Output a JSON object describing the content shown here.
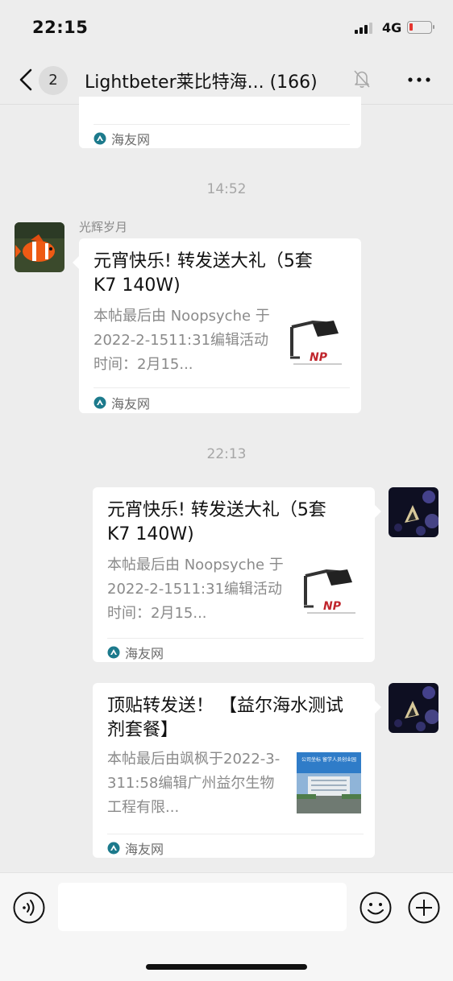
{
  "status_bar": {
    "time": "22:15",
    "network": "4G"
  },
  "nav": {
    "unread_count": "2",
    "title": "Lightbeter莱比特海...  (166)"
  },
  "messages": {
    "partial_card": {
      "source": "海友网"
    },
    "time1": "14:52",
    "msg1": {
      "sender": "光辉岁月",
      "title": "元宵快乐! 转发送大礼（5套K7  140W)",
      "desc": "本帖最后由 Noopsyche 于2022-2-1511:31编辑活动时间：2月15...",
      "source": "海友网"
    },
    "time2": "22:13",
    "msg2": {
      "title": "元宵快乐! 转发送大礼（5套K7  140W)",
      "desc": "本帖最后由 Noopsyche 于2022-2-1511:31编辑活动时间：2月15...",
      "source": "海友网"
    },
    "msg3": {
      "title": "顶贴转发送！ 【益尔海水测试剂套餐】",
      "desc": "本帖最后由飒枫于2022-3-311:58编辑广州益尔生物工程有限...",
      "source": "海友网",
      "thumb_text": "公司坐标 留学人员创业园"
    }
  },
  "input_bar": {
    "placeholder": ""
  }
}
